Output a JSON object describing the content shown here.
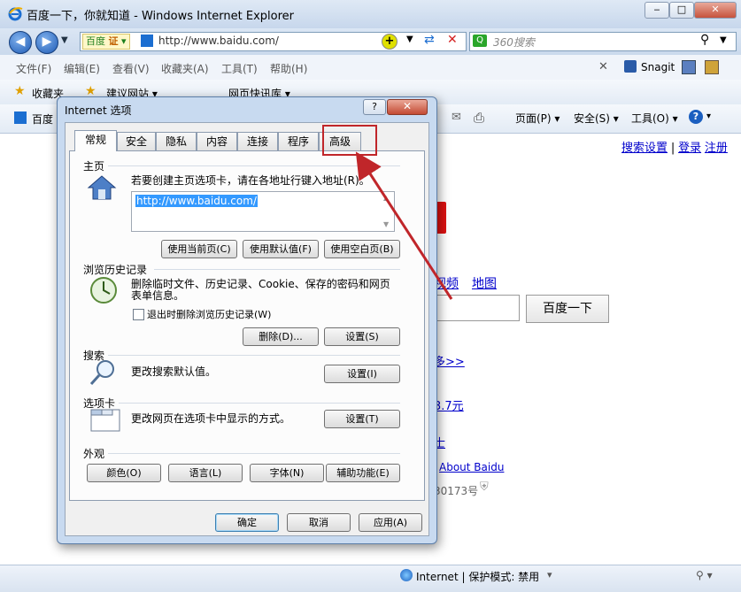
{
  "browser": {
    "title": "百度一下，你就知道 - Windows Internet Explorer",
    "address_badge": "百度",
    "address_badge2": "证",
    "address_url": "http://www.baidu.com/",
    "search_placeholder": "360搜索",
    "menu": [
      "文件(F)",
      "编辑(E)",
      "查看(V)",
      "收藏夹(A)",
      "工具(T)",
      "帮助(H)"
    ],
    "snagit": "Snagit",
    "favorites_label": "收藏夹",
    "fav_suggest": "建议网站 ▾",
    "fav_webslice": "网页快讯库 ▾",
    "tab_label": "百度",
    "cmd_page": "页面(P) ▾",
    "cmd_safety": "安全(S) ▾",
    "cmd_tools": "工具(O) ▾",
    "status_zone": "Internet | 保护模式: 禁用"
  },
  "page": {
    "top_links": [
      "搜索设置",
      "登录",
      "注册"
    ],
    "nav_links": [
      "视频",
      "地图"
    ],
    "search_button": "百度一下",
    "more_link": "多>>",
    "price_text": "3.7元",
    "link_shi": "士",
    "about_link": "About Baidu",
    "icp": "30173号"
  },
  "dialog": {
    "title": "Internet 选项",
    "help": "?",
    "close": "✕",
    "tabs": [
      "常规",
      "安全",
      "隐私",
      "内容",
      "连接",
      "程序",
      "高级"
    ],
    "home": {
      "label": "主页",
      "desc": "若要创建主页选项卡，请在各地址行键入地址(R)。",
      "url": "http://www.baidu.com/",
      "btn_current": "使用当前页(C)",
      "btn_default": "使用默认值(F)",
      "btn_blank": "使用空白页(B)"
    },
    "history": {
      "label": "浏览历史记录",
      "desc_line1": "删除临时文件、历史记录、Cookie、保存的密码和网页",
      "desc_line2": "表单信息。",
      "checkbox": "退出时删除浏览历史记录(W)",
      "btn_delete": "删除(D)...",
      "btn_settings": "设置(S)"
    },
    "search": {
      "label": "搜索",
      "desc": "更改搜索默认值。",
      "btn_settings": "设置(I)"
    },
    "tabs_group": {
      "label": "选项卡",
      "desc": "更改网页在选项卡中显示的方式。",
      "btn_settings": "设置(T)"
    },
    "appearance": {
      "label": "外观",
      "btn_colors": "颜色(O)",
      "btn_languages": "语言(L)",
      "btn_fonts": "字体(N)",
      "btn_accessibility": "辅助功能(E)"
    },
    "btn_ok": "确定",
    "btn_cancel": "取消",
    "btn_apply": "应用(A)"
  },
  "colors": {
    "annotation": "#c0262a",
    "selection": "#3399ff"
  }
}
